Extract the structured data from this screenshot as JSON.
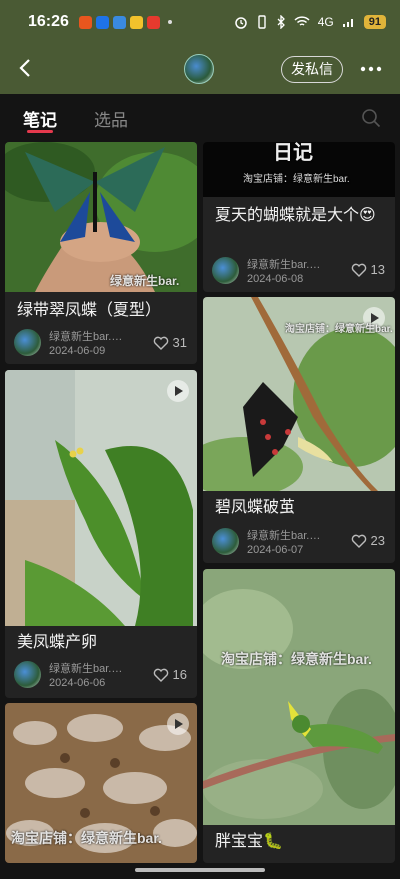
{
  "status": {
    "time": "16:26",
    "network": "4G",
    "battery": "91"
  },
  "header": {
    "dm_label": "发私信"
  },
  "tabs": {
    "notes": "笔记",
    "products": "选品"
  },
  "cards": [
    {
      "title": "绿带翠凤蝶（夏型）",
      "author": "绿意新生bar.…",
      "date": "2024-06-09",
      "likes": "31",
      "watermark": "绿意新生bar."
    },
    {
      "title": "美凤蝶产卵",
      "author": "绿意新生bar.…",
      "date": "2024-06-06",
      "likes": "16"
    },
    {
      "watermark": "淘宝店铺：绿意新生bar."
    },
    {
      "title": "夏天的蝴蝶就是大个😍",
      "author": "绿意新生bar.…",
      "date": "2024-06-08",
      "likes": "13",
      "watermark": "淘宝店铺：绿意新生bar.",
      "header_text": "日记"
    },
    {
      "title": "碧凤蝶破茧",
      "author": "绿意新生bar.…",
      "date": "2024-06-07",
      "likes": "23",
      "watermark": "淘宝店铺：绿意新生bar."
    },
    {
      "title": "胖宝宝🐛",
      "watermark": "淘宝店铺：绿意新生bar."
    }
  ]
}
